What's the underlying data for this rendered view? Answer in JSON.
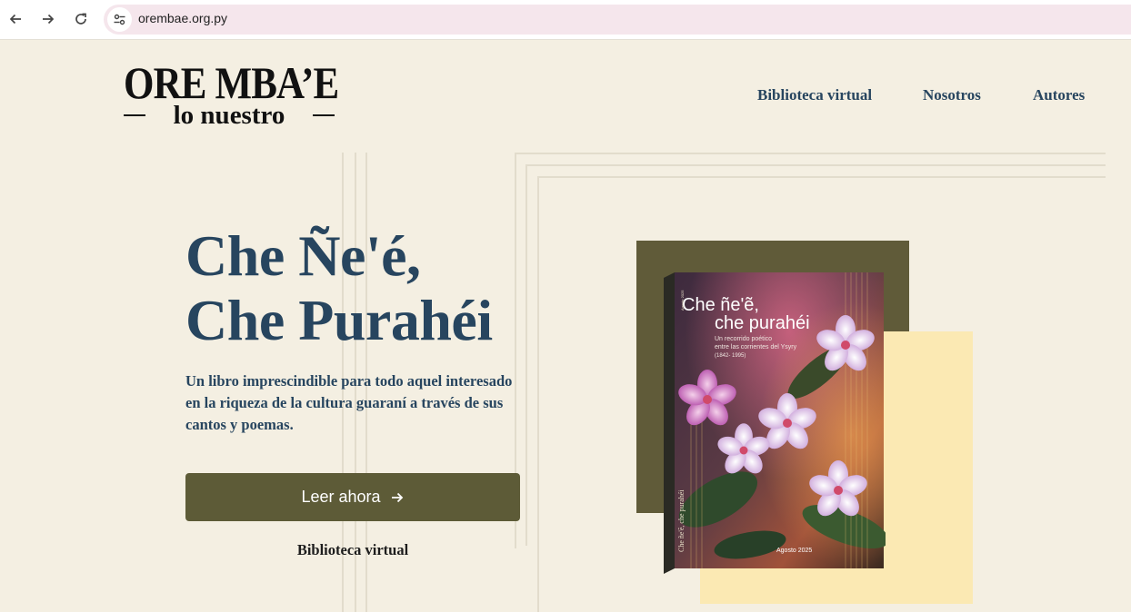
{
  "browser": {
    "back_icon": "arrow-left-icon",
    "forward_icon": "arrow-right-icon",
    "reload_icon": "reload-icon",
    "site_info_icon": "tune-icon",
    "url": "orembae.org.py"
  },
  "header": {
    "logo_main": "ORE MBA’E",
    "logo_sub": "lo nuestro",
    "nav": [
      {
        "label": "Biblioteca virtual"
      },
      {
        "label": "Nosotros"
      },
      {
        "label": "Autores"
      }
    ]
  },
  "hero": {
    "title_line1": "Che Ñe'é,",
    "title_line2": "Che Purahéi",
    "description": "Un libro imprescindible para todo aquel interesado en la riqueza de la cultura guaraní a través de sus cantos y poemas.",
    "cta_label": "Leer ahora",
    "cta_icon": "arrow-right-icon",
    "secondary_link": "Biblioteca virtual"
  },
  "book": {
    "title_line1": "Che  ñe'ẽ,",
    "title_line2": "che purahéi",
    "subtitle_line1": "Un recorrido poético",
    "subtitle_line2": "entre las corrientes del Ysyry",
    "years": "(1842- 1995)",
    "date": "Agosto 2025",
    "spine_title": "Che  ñe'ẽ,  che purahéi",
    "spine_date": "Agosto 2025",
    "colors": {
      "olive": "#605b39",
      "yellow": "#fbe9b3",
      "navy": "#27455f"
    }
  }
}
